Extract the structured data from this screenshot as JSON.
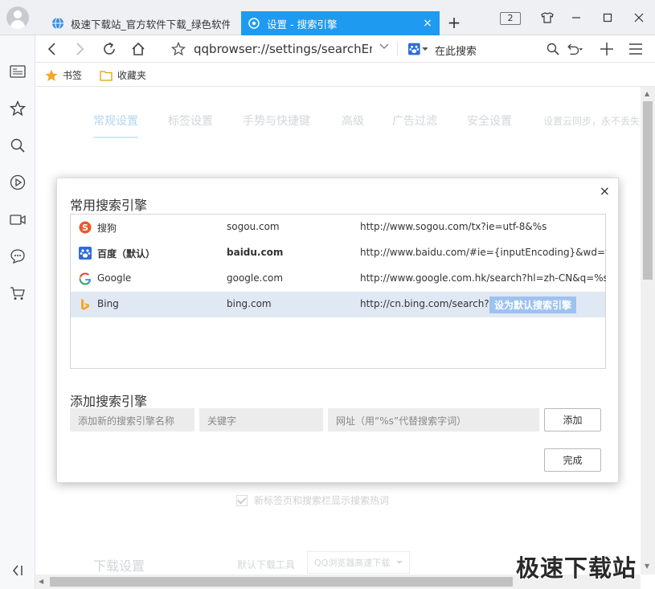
{
  "tabs": [
    {
      "title": "极速下载站_官方软件下载_绿色软件下载",
      "active": false
    },
    {
      "title": "设置 - 搜索引擎",
      "active": true,
      "close": "×"
    }
  ],
  "tab_count": "2",
  "new_tab": "+",
  "address": {
    "url": "qqbrowser://settings/searchEngi",
    "search_placeholder": "在此搜索"
  },
  "bookmarks": [
    {
      "label": "书签",
      "icon": "star-icon"
    },
    {
      "label": "收藏夹",
      "icon": "folder-icon"
    }
  ],
  "settings_tabs": [
    "常规设置",
    "标签设置",
    "手势与快捷键",
    "高级",
    "广告过滤",
    "安全设置"
  ],
  "sync_hint": "设置云同步，永不丢失",
  "hotword_option": "新标签页和搜索栏显示搜索热词",
  "download": {
    "title": "下载设置",
    "label": "默认下载工具",
    "selected": "QQ浏览器高速下载"
  },
  "modal": {
    "close": "×",
    "title": "常用搜索引擎",
    "engines": [
      {
        "name": "搜狗",
        "keyword": "sogou.com",
        "url": "http://www.sogou.com/tx?ie=utf-8&%s",
        "icon": "sogou-icon"
      },
      {
        "name": "百度（默认）",
        "keyword": "baidu.com",
        "url": "http://www.baidu.com/#ie={inputEncoding}&wd=%s",
        "icon": "baidu-icon",
        "default": true
      },
      {
        "name": "Google",
        "keyword": "google.com",
        "url": "http://www.google.com.hk/search?hl=zh-CN&q=%s",
        "icon": "google-icon"
      },
      {
        "name": "Bing",
        "keyword": "bing.com",
        "url": "http://cn.bing.com/search?...",
        "icon": "bing-icon",
        "selected": true
      }
    ],
    "set_default_label": "设为默认搜索引擎",
    "add_title": "添加搜索引擎",
    "add_name_placeholder": "添加新的搜索引擎名称",
    "add_keyword_placeholder": "关键字",
    "add_url_placeholder": "网址（用“%s”代替搜索字词）",
    "add_button": "添加",
    "done_button": "完成"
  },
  "watermark": "极速下载站",
  "colors": {
    "accent": "#1e9bf0",
    "selected_row": "#e0e8f3",
    "set_default_bg": "#9ec2ee"
  }
}
